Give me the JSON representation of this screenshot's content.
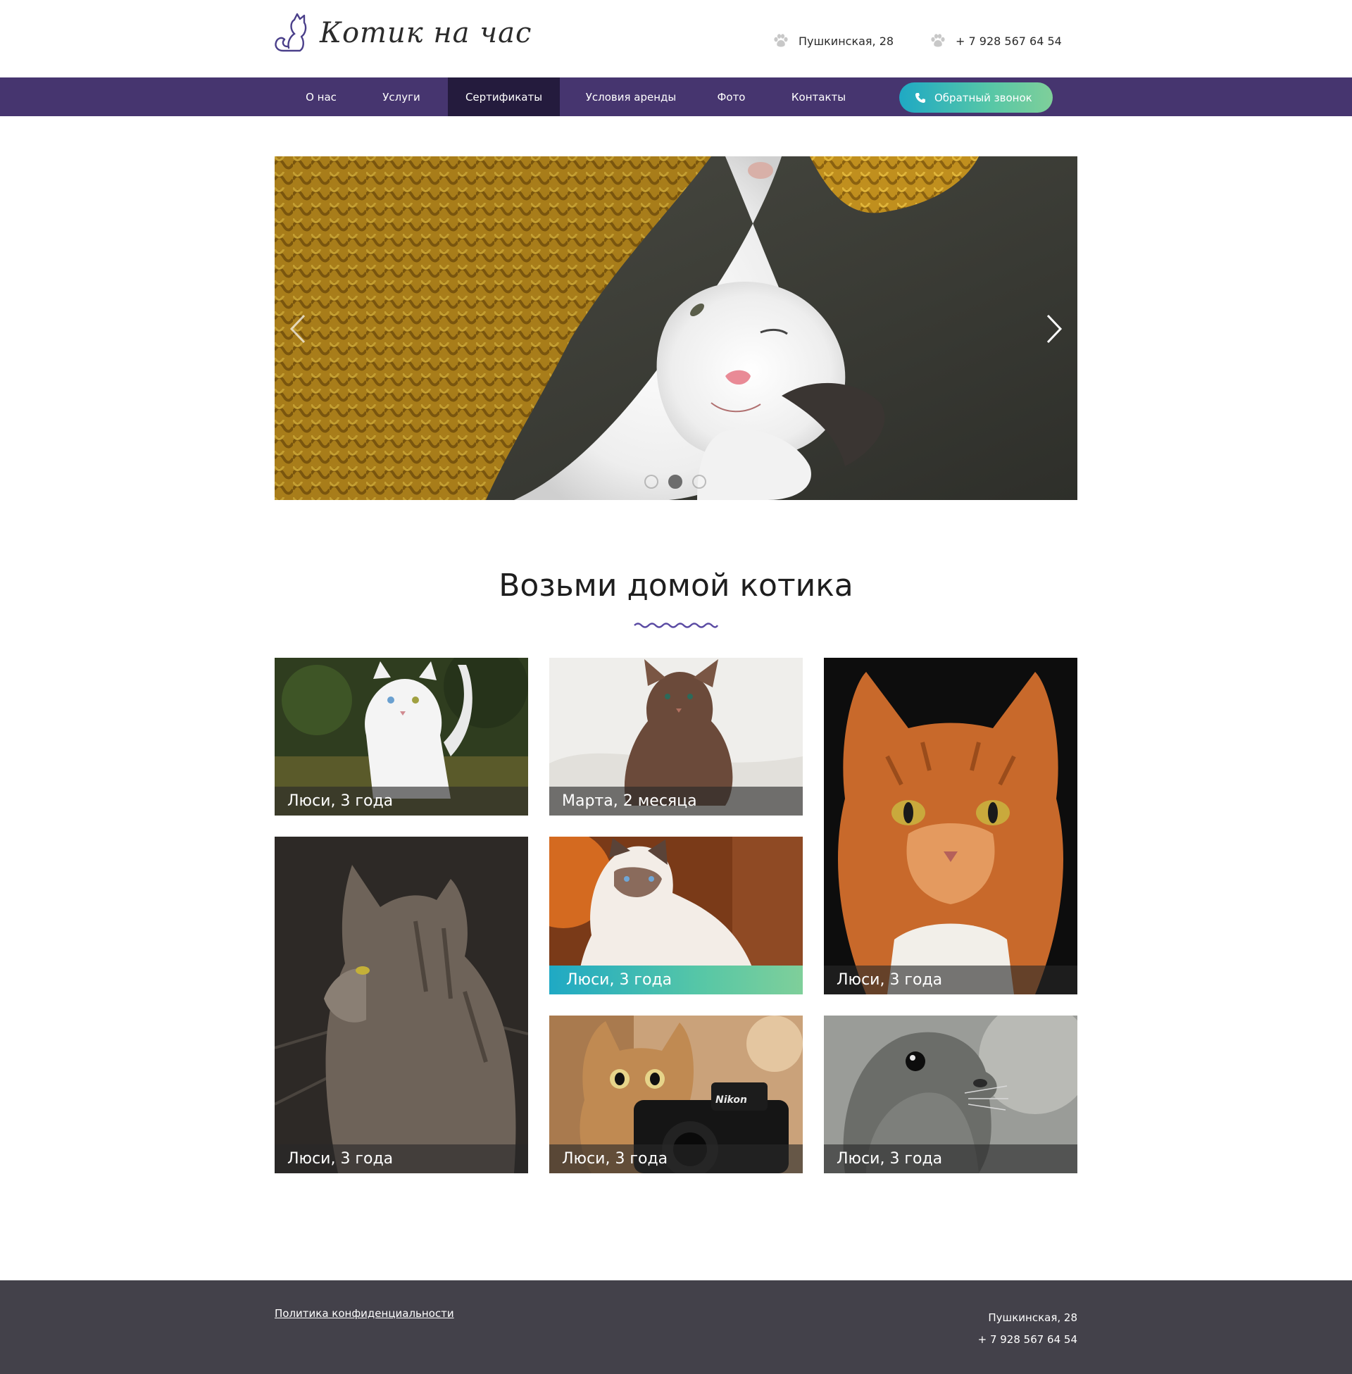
{
  "header": {
    "logo_text": "Котик на час",
    "address": "Пушкинская, 28",
    "phone": "+ 7 928 567 64 54"
  },
  "nav": {
    "items": [
      {
        "label": "О нас",
        "active": false
      },
      {
        "label": "Услуги",
        "active": false
      },
      {
        "label": "Сертификаты",
        "active": true
      },
      {
        "label": "Условия аренды",
        "active": false
      },
      {
        "label": "Фото",
        "active": false
      },
      {
        "label": "Контакты",
        "active": false
      }
    ],
    "callback_label": "Обратный звонок"
  },
  "slider": {
    "slide_count": 3,
    "active_slide": 2
  },
  "section": {
    "title": "Возьми домой котика"
  },
  "cards": [
    {
      "caption": "Люси, 3 года"
    },
    {
      "caption": "Марта, 2 месяца"
    },
    {
      "caption": "Люси, 3 года"
    },
    {
      "caption": "Люси, 3 года"
    },
    {
      "caption": "Люси, 3 года"
    },
    {
      "caption": "Люси, 3 года"
    },
    {
      "caption": "Люси, 3 года"
    }
  ],
  "footer": {
    "privacy_link": "Политика конфиденциальности",
    "address": "Пушкинская, 28",
    "phone": "+ 7 928 567 64 54"
  },
  "colors": {
    "nav_bg": "#46356f",
    "nav_active": "#241b3d",
    "accent_gradient_start": "#1fa9c4",
    "accent_gradient_end": "#7fcf9a",
    "footer_bg": "#43414a"
  },
  "icons": [
    "cat-logo-icon",
    "paw-icon",
    "phone-icon",
    "chevron-left-icon",
    "chevron-right-icon"
  ]
}
